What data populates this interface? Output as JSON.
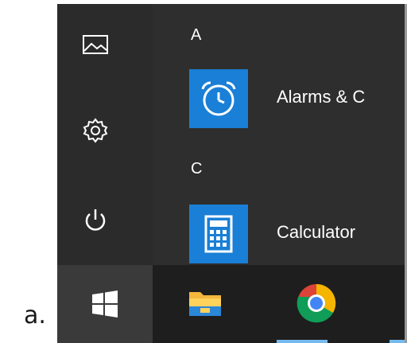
{
  "caption": "a.",
  "rail": {
    "items": [
      {
        "icon": "pictures-icon"
      },
      {
        "icon": "settings-gear-icon"
      },
      {
        "icon": "power-icon"
      }
    ]
  },
  "app_list": [
    {
      "letter": "A",
      "app": {
        "label": "Alarms & C",
        "icon": "alarm-clock-icon"
      }
    },
    {
      "letter": "C",
      "app": {
        "label": "Calculator",
        "icon": "calculator-icon"
      }
    }
  ],
  "taskbar": {
    "start_icon": "windows-logo-icon",
    "apps": [
      {
        "icon": "file-explorer-icon"
      },
      {
        "icon": "chrome-icon"
      }
    ]
  },
  "colors": {
    "tile": "#1a7fd6",
    "panel": "#2b2b2b",
    "taskbar": "#1e1e1e",
    "accent_underline": "#76b9ed"
  }
}
